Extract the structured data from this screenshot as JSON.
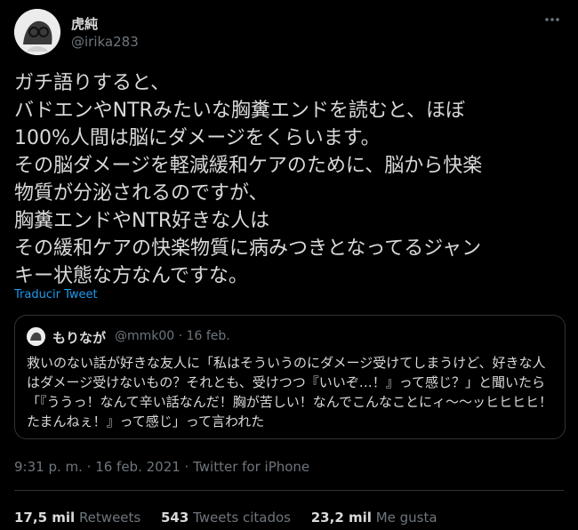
{
  "tweet": {
    "author_name": "虎純",
    "author_handle": "@irika283",
    "text": "ガチ語りすると、\nバドエンやNTRみたいな胸糞エンドを読むと、ほぼ\n100%人間は脳にダメージをくらいます。\nその脳ダメージを軽減緩和ケアのために、脳から快楽\n物質が分泌されるのですが、\n胸糞エンドやNTR好きな人は\nその緩和ケアの快楽物質に病みつきとなってるジャン\nキー状態な方なんですな。",
    "translate_label": "Traducir Tweet",
    "more_icon": "more-dots-icon",
    "timestamp": "9:31 p. m. · 16 feb. 2021 · Twitter for iPhone"
  },
  "quote": {
    "author_name": "もりなが",
    "meta": "@mmk00 · 16 feb.",
    "text": "救いのない話が好きな友人に「私はそういうのにダメージ受けてしまうけど、好きな人はダメージ受けないもの？それとも、受けつつ『いいぞ…！』って感じ？」と聞いたら「『ううっ！なんて辛い話なんだ！胸が苦しい！なんでこんなことにィ〜〜ッヒヒヒヒ！たまんねぇ！』って感じ」って言われた"
  },
  "stats": {
    "retweets_count": "17,5 mil",
    "retweets_label": "Retweets",
    "quotes_count": "543",
    "quotes_label": "Tweets citados",
    "likes_count": "23,2 mil",
    "likes_label": "Me gusta"
  },
  "colors": {
    "background": "#000000",
    "text": "#d9d9d9",
    "secondary": "#6e767d",
    "link": "#1d9bf0",
    "border": "#2f3336"
  }
}
